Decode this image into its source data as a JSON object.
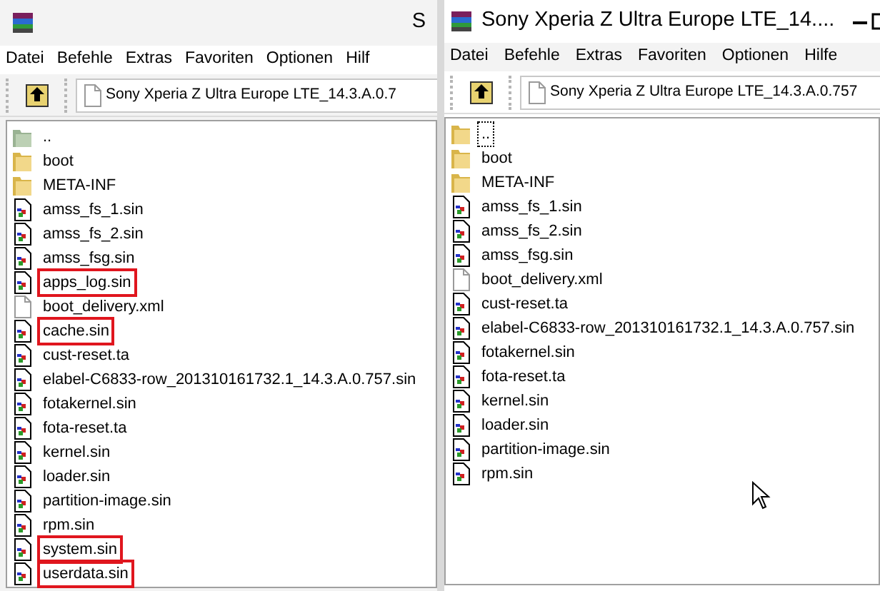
{
  "windows": [
    {
      "title": "S",
      "menu": [
        "Datei",
        "Befehle",
        "Extras",
        "Favoriten",
        "Optionen",
        "Hilf"
      ],
      "address": "Sony Xperia Z Ultra Europe LTE_14.3.A.0.7",
      "window_controls": false,
      "files": [
        {
          "name": "..",
          "kind": "parent",
          "highlighted": false,
          "focused": false
        },
        {
          "name": "boot",
          "kind": "folder",
          "highlighted": false,
          "focused": false
        },
        {
          "name": "META-INF",
          "kind": "folder",
          "highlighted": false,
          "focused": false
        },
        {
          "name": "amss_fs_1.sin",
          "kind": "sin",
          "highlighted": false,
          "focused": false
        },
        {
          "name": "amss_fs_2.sin",
          "kind": "sin",
          "highlighted": false,
          "focused": false
        },
        {
          "name": "amss_fsg.sin",
          "kind": "sin",
          "highlighted": false,
          "focused": false
        },
        {
          "name": "apps_log.sin",
          "kind": "sin",
          "highlighted": true,
          "focused": false
        },
        {
          "name": "boot_delivery.xml",
          "kind": "plain",
          "highlighted": false,
          "focused": false
        },
        {
          "name": "cache.sin",
          "kind": "sin",
          "highlighted": true,
          "focused": false
        },
        {
          "name": "cust-reset.ta",
          "kind": "sin",
          "highlighted": false,
          "focused": false
        },
        {
          "name": "elabel-C6833-row_201310161732.1_14.3.A.0.757.sin",
          "kind": "sin",
          "highlighted": false,
          "focused": false
        },
        {
          "name": "fotakernel.sin",
          "kind": "sin",
          "highlighted": false,
          "focused": false
        },
        {
          "name": "fota-reset.ta",
          "kind": "sin",
          "highlighted": false,
          "focused": false
        },
        {
          "name": "kernel.sin",
          "kind": "sin",
          "highlighted": false,
          "focused": false
        },
        {
          "name": "loader.sin",
          "kind": "sin",
          "highlighted": false,
          "focused": false
        },
        {
          "name": "partition-image.sin",
          "kind": "sin",
          "highlighted": false,
          "focused": false
        },
        {
          "name": "rpm.sin",
          "kind": "sin",
          "highlighted": false,
          "focused": false
        },
        {
          "name": "system.sin",
          "kind": "sin",
          "highlighted": true,
          "focused": false
        },
        {
          "name": "userdata.sin",
          "kind": "sin",
          "highlighted": true,
          "focused": false
        }
      ]
    },
    {
      "title": "Sony Xperia Z Ultra Europe LTE_14....",
      "menu": [
        "Datei",
        "Befehle",
        "Extras",
        "Favoriten",
        "Optionen",
        "Hilfe"
      ],
      "address": "Sony Xperia Z Ultra Europe LTE_14.3.A.0.757",
      "window_controls": true,
      "files": [
        {
          "name": "..",
          "kind": "folder",
          "highlighted": false,
          "focused": true
        },
        {
          "name": "boot",
          "kind": "folder",
          "highlighted": false,
          "focused": false
        },
        {
          "name": "META-INF",
          "kind": "folder",
          "highlighted": false,
          "focused": false
        },
        {
          "name": "amss_fs_1.sin",
          "kind": "sin",
          "highlighted": false,
          "focused": false
        },
        {
          "name": "amss_fs_2.sin",
          "kind": "sin",
          "highlighted": false,
          "focused": false
        },
        {
          "name": "amss_fsg.sin",
          "kind": "sin",
          "highlighted": false,
          "focused": false
        },
        {
          "name": "boot_delivery.xml",
          "kind": "plain",
          "highlighted": false,
          "focused": false
        },
        {
          "name": "cust-reset.ta",
          "kind": "sin",
          "highlighted": false,
          "focused": false
        },
        {
          "name": "elabel-C6833-row_201310161732.1_14.3.A.0.757.sin",
          "kind": "sin",
          "highlighted": false,
          "focused": false
        },
        {
          "name": "fotakernel.sin",
          "kind": "sin",
          "highlighted": false,
          "focused": false
        },
        {
          "name": "fota-reset.ta",
          "kind": "sin",
          "highlighted": false,
          "focused": false
        },
        {
          "name": "kernel.sin",
          "kind": "sin",
          "highlighted": false,
          "focused": false
        },
        {
          "name": "loader.sin",
          "kind": "sin",
          "highlighted": false,
          "focused": false
        },
        {
          "name": "partition-image.sin",
          "kind": "sin",
          "highlighted": false,
          "focused": false
        },
        {
          "name": "rpm.sin",
          "kind": "sin",
          "highlighted": false,
          "focused": false
        }
      ]
    }
  ]
}
